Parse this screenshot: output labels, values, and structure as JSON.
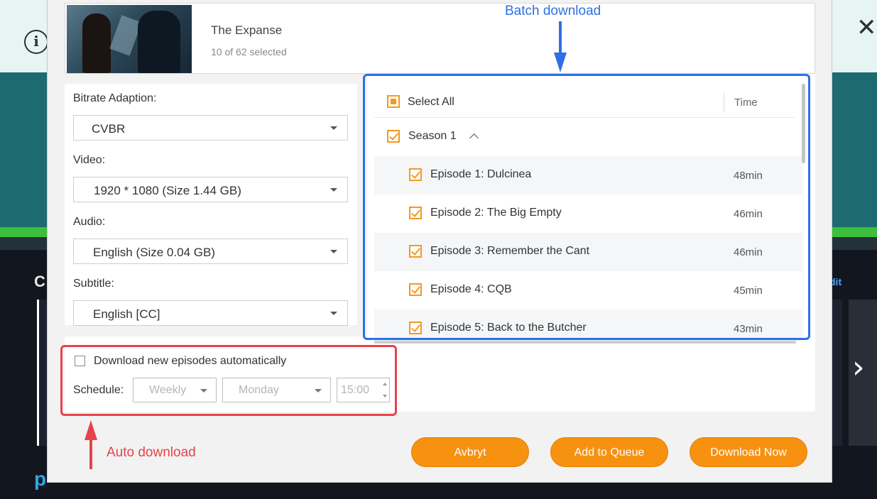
{
  "colors": {
    "accent_orange": "#f79110",
    "annotation_blue": "#2f6fe4",
    "annotation_red": "#e8424b"
  },
  "background": {
    "row_initial": "C",
    "edit_fragment": "dit",
    "brand_fragment": "p"
  },
  "show": {
    "title": "The Expanse",
    "selection": "10 of 62 selected"
  },
  "settings": {
    "bitrate_label": "Bitrate Adaption:",
    "bitrate_value": "CVBR",
    "video_label": "Video:",
    "video_value": "1920 * 1080 (Size 1.44 GB)",
    "audio_label": "Audio:",
    "audio_value": "English (Size 0.04 GB)",
    "subtitle_label": "Subtitle:",
    "subtitle_value": "English [CC]"
  },
  "episodes_list": {
    "select_all": "Select All",
    "time_header": "Time",
    "season": "Season 1",
    "items": [
      {
        "title": "Episode 1: Dulcinea",
        "time": "48min"
      },
      {
        "title": "Episode 2: The Big Empty",
        "time": "46min"
      },
      {
        "title": "Episode 3: Remember the Cant",
        "time": "46min"
      },
      {
        "title": "Episode 4: CQB",
        "time": "45min"
      },
      {
        "title": "Episode 5: Back to the Butcher",
        "time": "43min"
      }
    ]
  },
  "auto_download": {
    "checkbox_label": "Download new episodes automatically",
    "schedule_label": "Schedule:",
    "frequency": "Weekly",
    "day": "Monday",
    "time": "15:00"
  },
  "buttons": {
    "cancel": "Avbryt",
    "add_to_queue": "Add to Queue",
    "download_now": "Download Now"
  },
  "annotations": {
    "batch": "Batch download",
    "auto": "Auto download"
  }
}
